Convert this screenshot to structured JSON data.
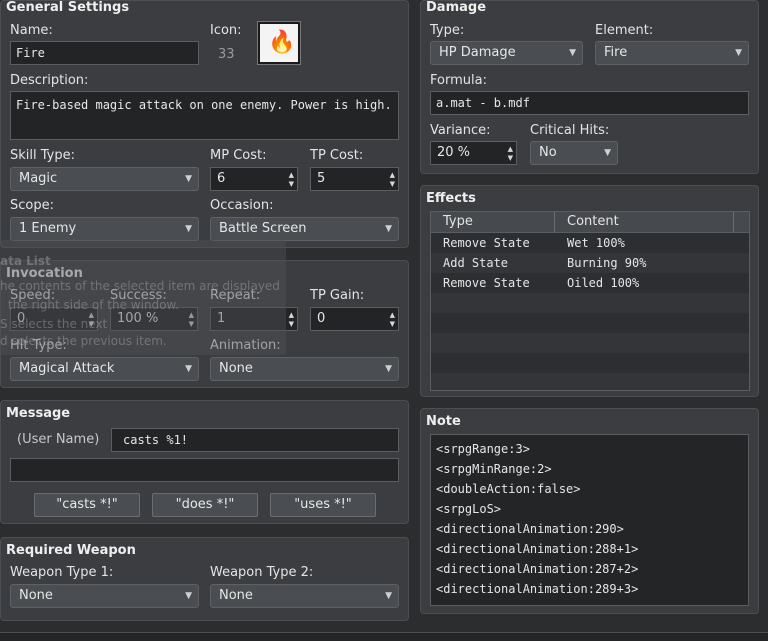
{
  "general": {
    "title": "General Settings",
    "name_label": "Name:",
    "name_value": "Fire",
    "icon_label": "Icon:",
    "icon_index": "33",
    "icon_glyph": "🔥",
    "description_label": "Description:",
    "description_value": "Fire-based magic attack on one enemy. Power is high.",
    "skill_type_label": "Skill Type:",
    "skill_type_value": "Magic",
    "mp_cost_label": "MP Cost:",
    "mp_cost_value": "6",
    "tp_cost_label": "TP Cost:",
    "tp_cost_value": "5",
    "scope_label": "Scope:",
    "scope_value": "1 Enemy",
    "occasion_label": "Occasion:",
    "occasion_value": "Battle Screen"
  },
  "invocation": {
    "title": "Invocation",
    "speed_label": "Speed:",
    "speed_value": "0",
    "success_label": "Success:",
    "success_value": "100 %",
    "repeat_label": "Repeat:",
    "repeat_value": "1",
    "tp_gain_label": "TP Gain:",
    "tp_gain_value": "0",
    "hit_type_label": "Hit Type:",
    "hit_type_value": "Magical Attack",
    "animation_label": "Animation:",
    "animation_value": "None"
  },
  "tooltip": {
    "lines": [
      "ata List",
      "he contents of the selected item are displayed",
      "the right side of the window.",
      "S selects the next",
      "d selects the previous item."
    ]
  },
  "message": {
    "title": "Message",
    "user_name_label": "(User Name)",
    "line1_value": "casts %1!",
    "line2_value": "",
    "buttons": [
      "\"casts *!\"",
      "\"does *!\"",
      "\"uses *!\""
    ]
  },
  "required_weapon": {
    "title": "Required Weapon",
    "type1_label": "Weapon Type 1:",
    "type1_value": "None",
    "type2_label": "Weapon Type 2:",
    "type2_value": "None"
  },
  "damage": {
    "title": "Damage",
    "type_label": "Type:",
    "type_value": "HP Damage",
    "element_label": "Element:",
    "element_value": "Fire",
    "formula_label": "Formula:",
    "formula_value": "a.mat - b.mdf",
    "variance_label": "Variance:",
    "variance_value": "20 %",
    "critical_label": "Critical Hits:",
    "critical_value": "No"
  },
  "effects": {
    "title": "Effects",
    "columns": [
      "Type",
      "Content"
    ],
    "rows": [
      {
        "type": "Remove State",
        "content": "Wet 100%"
      },
      {
        "type": "Add State",
        "content": "Burning 90%"
      },
      {
        "type": "Remove State",
        "content": "Oiled 100%"
      }
    ]
  },
  "note": {
    "title": "Note",
    "lines": [
      "<srpgRange:3>",
      "<srpgMinRange:2>",
      "<doubleAction:false>",
      "<srpgLoS>",
      "<directionalAnimation:290>",
      "<directionalAnimation:288+1>",
      "<directionalAnimation:287+2>",
      "<directionalAnimation:289+3>"
    ]
  },
  "icons": {
    "dropdown": "chevron-down-icon",
    "spin_up": "spin-up-icon",
    "spin_down": "spin-down-icon",
    "skill_icon": "fire-icon"
  }
}
